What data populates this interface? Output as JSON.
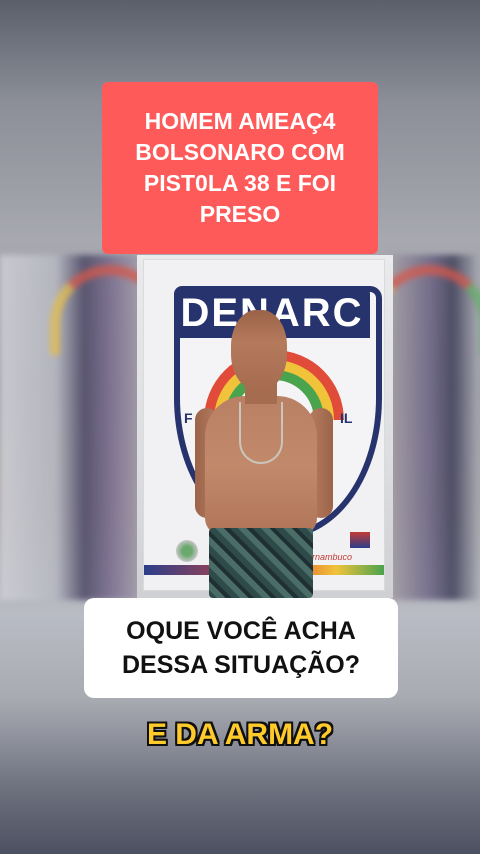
{
  "headline": {
    "lines": [
      "HOMEM AMEAÇ4",
      "BOLSONARO COM",
      "PIST0LA 38 E FOI",
      "PRESO"
    ],
    "background_color": "#ff5a5a"
  },
  "photo": {
    "banner_title": "DENARC",
    "shield_text_left": "F",
    "shield_text_right": "IL",
    "logo_right_text": "rnambuco"
  },
  "question": {
    "lines": [
      "OQUE VOCÊ ACHA",
      "DESSA SITUAÇÃO?"
    ]
  },
  "caption": {
    "text": "E DA ARMA?",
    "color": "#ffcb2b"
  }
}
